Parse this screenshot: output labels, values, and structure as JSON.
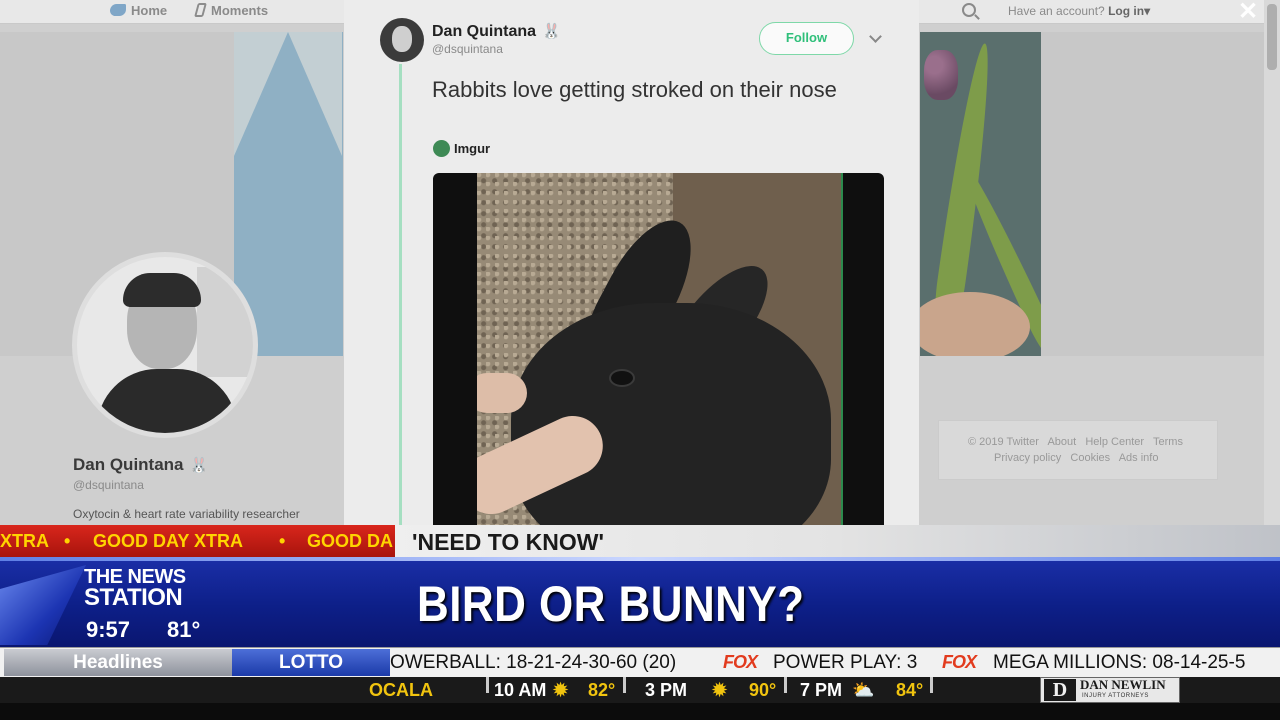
{
  "nav": {
    "home": "Home",
    "moments": "Moments",
    "account_prompt": "Have an account?",
    "login": "Log in",
    "login_caret": "▾",
    "close": "✕"
  },
  "profile": {
    "name": "Dan Quintana",
    "bunny": "🐰",
    "handle": "@dsquintana",
    "bio": "Oxytocin & heart rate variability researcher"
  },
  "footer": {
    "line1": "© 2019 Twitter   About   Help Center   Terms",
    "line2": "Privacy policy   Cookies   Ads info"
  },
  "tweet": {
    "name": "Dan Quintana",
    "bunny": "🐰",
    "handle": "@dsquintana",
    "follow_label": "Follow",
    "text": "Rabbits love getting stroked on their nose",
    "source": "Imgur"
  },
  "tv": {
    "crawl": [
      "XTRA",
      "•",
      "GOOD DAY XTRA",
      "•",
      "GOOD DA"
    ],
    "section_label": "'NEED TO KNOW'",
    "station_line1": "THE NEWS",
    "station_line2": "STATION",
    "time": "9:57",
    "temp": "81°",
    "headline": "BIRD OR BUNNY?",
    "tab_headlines": "Headlines",
    "tab_lotto": "LOTTO",
    "lotto": {
      "powerball": "OWERBALL: 18-21-24-30-60 (20)",
      "fox1": "FOX",
      "power_play": "POWER PLAY: 3",
      "fox2": "FOX",
      "mega": "MEGA MILLIONS: 08-14-25-5"
    },
    "weather": {
      "city": "OCALA",
      "t1_time": "10 AM",
      "t1_temp": "82°",
      "t2_time": "3 PM",
      "t2_temp": "90°",
      "t3_time": "7 PM",
      "t3_temp": "84°"
    },
    "sponsor": {
      "initial": "D",
      "name": "DAN NEWLIN",
      "sub": "INJURY ATTORNEYS"
    }
  }
}
